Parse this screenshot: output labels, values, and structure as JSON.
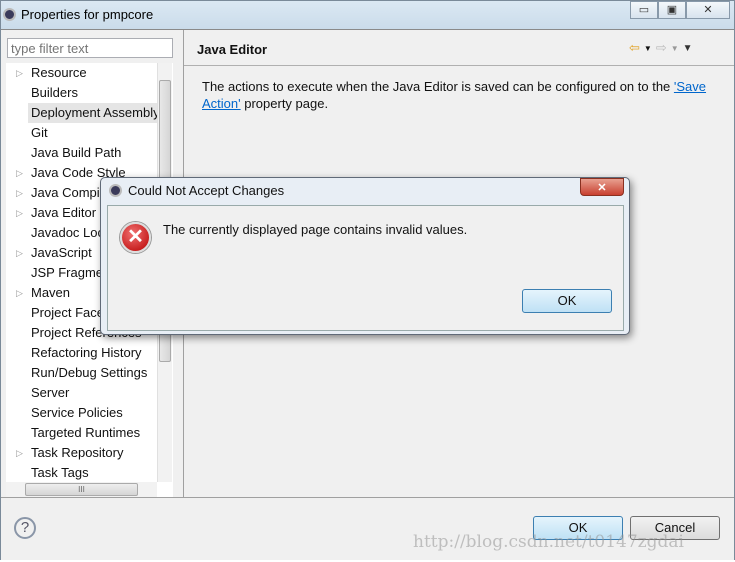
{
  "window": {
    "title": "Properties for pmpcore",
    "controls": [
      "minimize",
      "maximize",
      "close"
    ]
  },
  "filter": {
    "placeholder": "type filter text"
  },
  "tree": {
    "items": [
      {
        "label": "Resource",
        "expandable": true
      },
      {
        "label": "Builders",
        "expandable": false
      },
      {
        "label": "Deployment Assembly",
        "expandable": false,
        "selected": true
      },
      {
        "label": "Git",
        "expandable": false
      },
      {
        "label": "Java Build Path",
        "expandable": false
      },
      {
        "label": "Java Code Style",
        "expandable": true
      },
      {
        "label": "Java Compiler",
        "expandable": true
      },
      {
        "label": "Java Editor",
        "expandable": true
      },
      {
        "label": "Javadoc Location",
        "expandable": false
      },
      {
        "label": "JavaScript",
        "expandable": true
      },
      {
        "label": "JSP Fragment",
        "expandable": false
      },
      {
        "label": "Maven",
        "expandable": true
      },
      {
        "label": "Project Facets",
        "expandable": false
      },
      {
        "label": "Project References",
        "expandable": false
      },
      {
        "label": "Refactoring History",
        "expandable": false
      },
      {
        "label": "Run/Debug Settings",
        "expandable": false
      },
      {
        "label": "Server",
        "expandable": false
      },
      {
        "label": "Service Policies",
        "expandable": false
      },
      {
        "label": "Targeted Runtimes",
        "expandable": false
      },
      {
        "label": "Task Repository",
        "expandable": true
      },
      {
        "label": "Task Tags",
        "expandable": false
      }
    ]
  },
  "page": {
    "title": "Java Editor",
    "desc_before": "The actions to execute when the Java Editor is saved can be configured on to the ",
    "link": "'Save Action'",
    "desc_after": " property page."
  },
  "buttons": {
    "ok": "OK",
    "cancel": "Cancel",
    "help": "?"
  },
  "dialog": {
    "title": "Could Not Accept Changes",
    "message": "The currently displayed page contains invalid values.",
    "ok": "OK",
    "icon": "error-icon"
  },
  "watermark": "http://blog.csdn.net/t0147zgdai"
}
